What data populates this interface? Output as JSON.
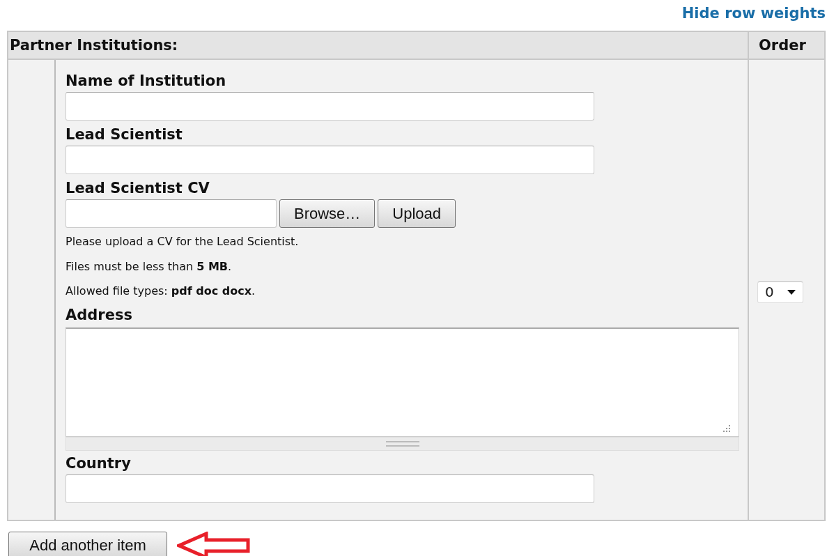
{
  "header_link": "Hide row weights",
  "table": {
    "columns": [
      "Partner Institutions:",
      "Order"
    ],
    "row": {
      "fields": [
        {
          "kind": "text",
          "label": "Name of Institution"
        },
        {
          "kind": "text",
          "label": "Lead Scientist"
        },
        {
          "kind": "file",
          "label": "Lead Scientist CV",
          "buttons": [
            "Browse…",
            "Upload"
          ],
          "help": [
            "Please upload a CV for the Lead Scientist.",
            "Files must be less than **5 MB**.",
            "Allowed file types: **pdf doc docx**."
          ]
        },
        {
          "kind": "textarea",
          "label": "Address"
        },
        {
          "kind": "text",
          "label": "Country"
        }
      ],
      "order": "0"
    }
  },
  "add_button": "Add another item"
}
